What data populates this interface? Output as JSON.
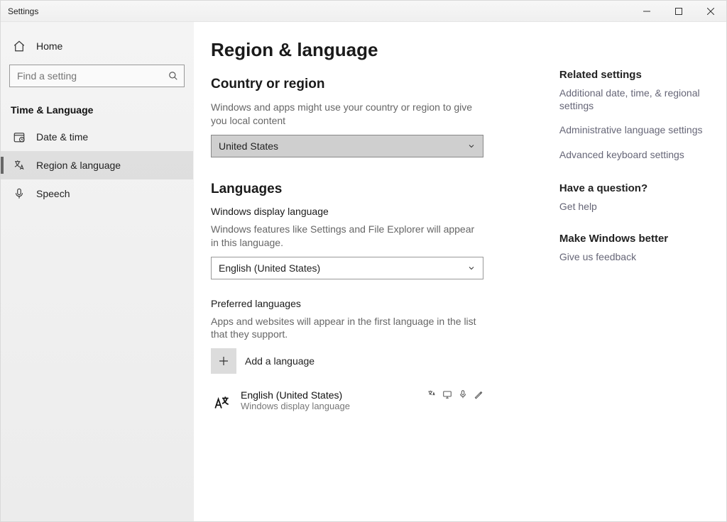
{
  "window": {
    "title": "Settings"
  },
  "sidebar": {
    "home_label": "Home",
    "search_placeholder": "Find a setting",
    "section_title": "Time & Language",
    "items": [
      {
        "label": "Date & time"
      },
      {
        "label": "Region & language"
      },
      {
        "label": "Speech"
      }
    ]
  },
  "page": {
    "title": "Region & language",
    "country": {
      "heading": "Country or region",
      "desc": "Windows and apps might use your country or region to give you local content",
      "value": "United States"
    },
    "languages": {
      "heading": "Languages",
      "display_label": "Windows display language",
      "display_desc": "Windows features like Settings and File Explorer will appear in this language.",
      "display_value": "English (United States)",
      "preferred_label": "Preferred languages",
      "preferred_desc": "Apps and websites will appear in the first language in the list that they support.",
      "add_label": "Add a language",
      "installed": [
        {
          "name": "English (United States)",
          "sub": "Windows display language"
        }
      ]
    }
  },
  "side": {
    "related_title": "Related settings",
    "links": [
      "Additional date, time, & regional settings",
      "Administrative language settings",
      "Advanced keyboard settings"
    ],
    "question_title": "Have a question?",
    "help_link": "Get help",
    "feedback_title": "Make Windows better",
    "feedback_link": "Give us feedback"
  }
}
